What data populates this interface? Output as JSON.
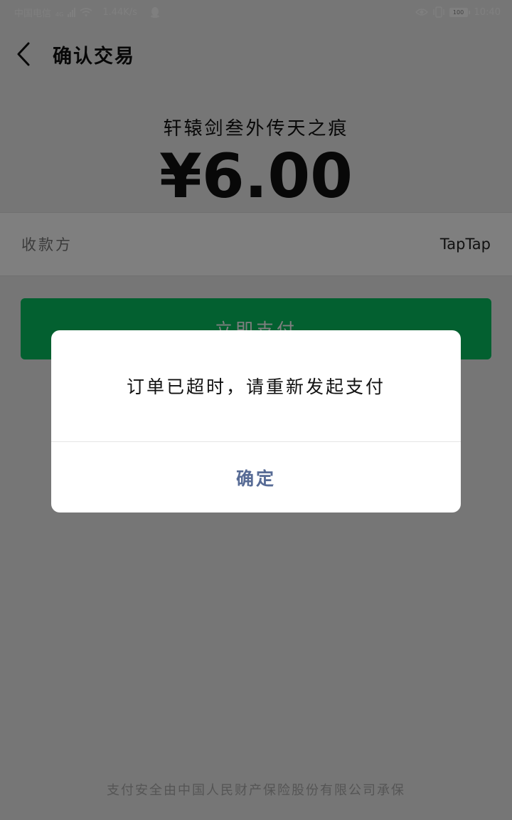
{
  "status_bar": {
    "carrier": "中国电信",
    "network": "4G",
    "speed": "1.44K/s",
    "battery": "100",
    "time": "10:40"
  },
  "header": {
    "title": "确认交易"
  },
  "product": {
    "name": "轩辕剑叁外传天之痕",
    "price": "¥6.00"
  },
  "payee": {
    "label": "收款方",
    "value": "TapTap"
  },
  "pay_button": {
    "label": "立即支付"
  },
  "footer": {
    "note": "支付安全由中国人民财产保险股份有限公司承保"
  },
  "dialog": {
    "message": "订单已超时，请重新发起支付",
    "confirm_label": "确定"
  },
  "colors": {
    "accent_green": "#07c160",
    "link_blue": "#576b95",
    "overlay": "rgba(0,0,0,0.5)"
  },
  "icons": {
    "back": "chevron-left-icon",
    "wifi": "wifi-icon",
    "qq": "qq-icon",
    "eye": "eye-icon",
    "vibrate": "vibrate-icon",
    "battery": "battery-icon"
  }
}
